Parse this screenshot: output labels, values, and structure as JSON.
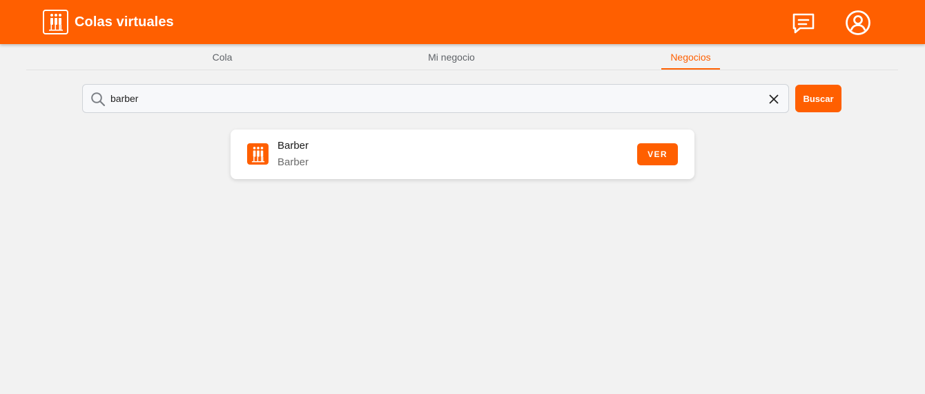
{
  "header": {
    "title": "Colas virtuales",
    "logo_icon": "queue-people-icon",
    "chat_icon": "chat-icon",
    "account_icon": "account-circle-icon",
    "bg_color": "#ff5f00"
  },
  "tabs": [
    {
      "label": "Cola",
      "active": false
    },
    {
      "label": "Mi negocio",
      "active": false
    },
    {
      "label": "Negocios",
      "active": true
    }
  ],
  "search": {
    "value": "barber",
    "placeholder": "",
    "button_label": "Buscar"
  },
  "results": [
    {
      "name": "Barber",
      "description": "Barber",
      "action_label": "VER",
      "icon": "queue-people-icon"
    }
  ],
  "colors": {
    "accent": "#ff5f00",
    "background": "#f2f2f2"
  }
}
